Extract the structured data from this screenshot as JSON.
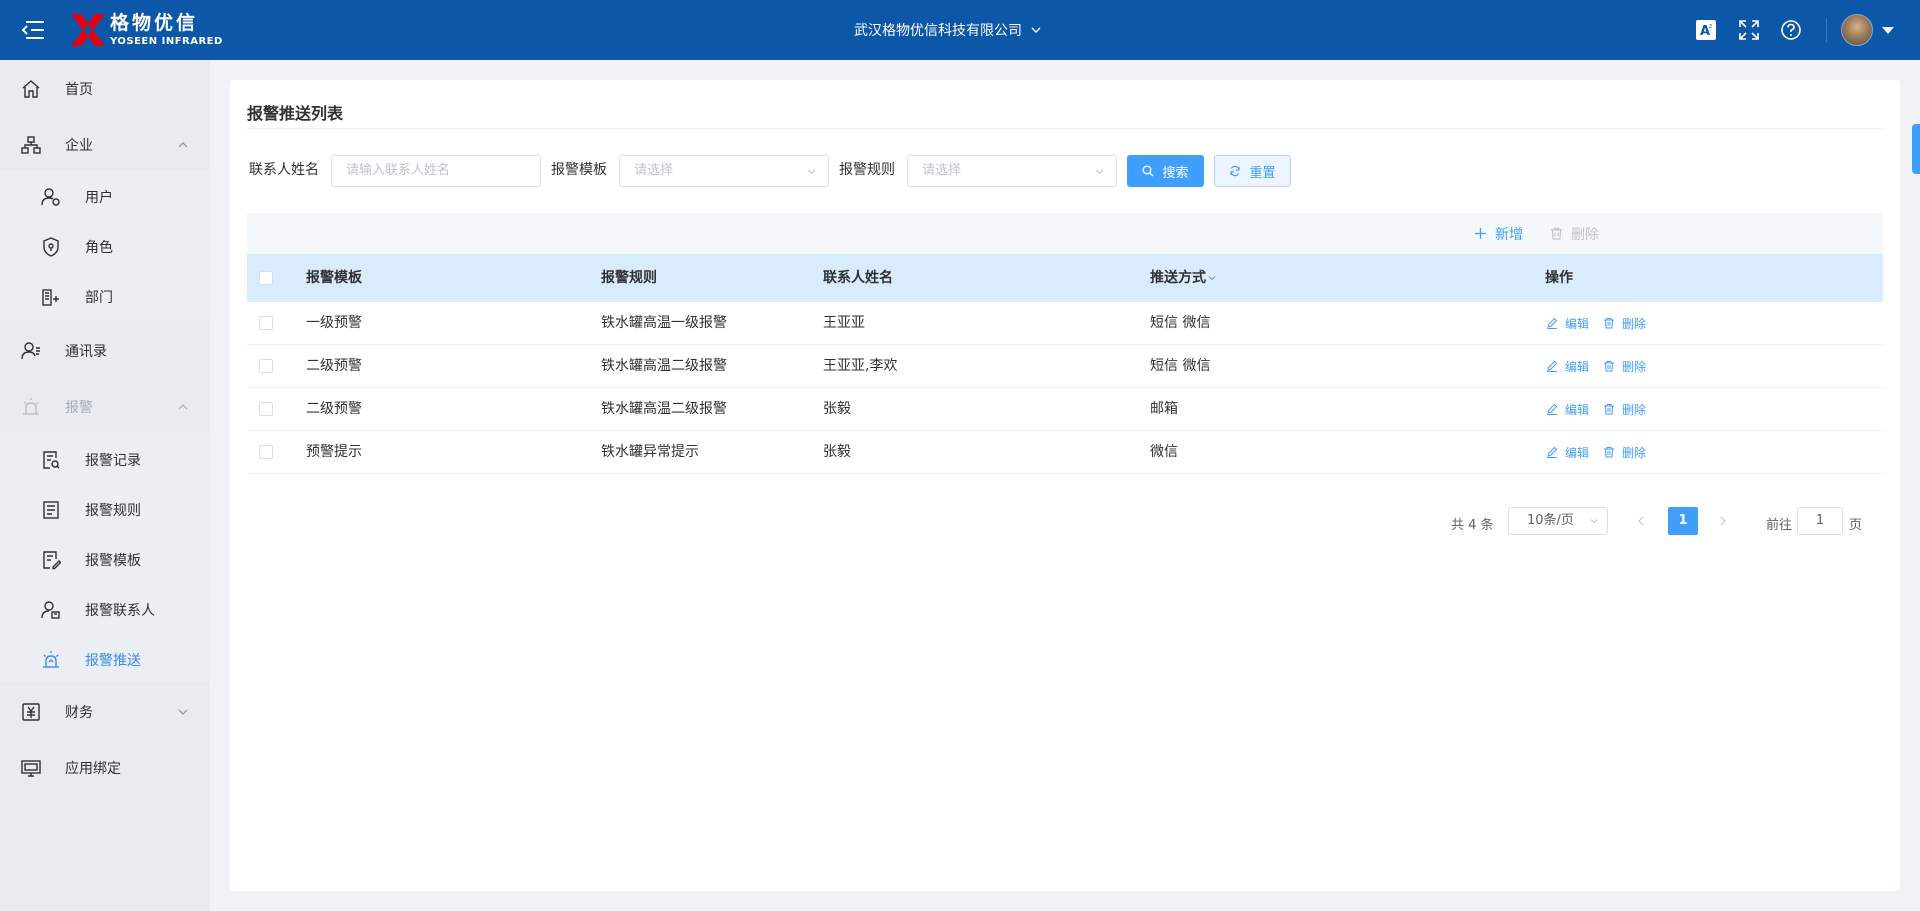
{
  "header": {
    "logo_cn": "格物优信",
    "logo_en": "YOSEEN INFRARED",
    "company": "武汉格物优信科技有限公司"
  },
  "sidebar": {
    "home": "首页",
    "enterprise": "企业",
    "enterprise_items": [
      "用户",
      "角色",
      "部门"
    ],
    "contacts": "通讯录",
    "alarm": "报警",
    "alarm_items": [
      "报警记录",
      "报警规则",
      "报警模板",
      "报警联系人",
      "报警推送"
    ],
    "finance": "财务",
    "app_binding": "应用绑定"
  },
  "page": {
    "title": "报警推送列表"
  },
  "filters": {
    "contact_label": "联系人姓名",
    "contact_placeholder": "请输入联系人姓名",
    "template_label": "报警模板",
    "template_placeholder": "请选择",
    "rule_label": "报警规则",
    "rule_placeholder": "请选择",
    "search_button": "搜索",
    "reset_button": "重置"
  },
  "toolbar": {
    "add": "新增",
    "delete": "删除"
  },
  "table": {
    "columns": [
      "报警模板",
      "报警规则",
      "联系人姓名",
      "推送方式",
      "操作"
    ],
    "rows": [
      {
        "template": "一级预警",
        "rule": "铁水罐高温一级报警",
        "contact": "王亚亚",
        "method": "短信 微信",
        "edit": "编辑",
        "delete": "删除"
      },
      {
        "template": "二级预警",
        "rule": "铁水罐高温二级报警",
        "contact": "王亚亚,李欢",
        "method": "短信 微信",
        "edit": "编辑",
        "delete": "删除"
      },
      {
        "template": "二级预警",
        "rule": "铁水罐高温二级报警",
        "contact": "张毅",
        "method": "邮箱",
        "edit": "编辑",
        "delete": "删除"
      },
      {
        "template": "预警提示",
        "rule": "铁水罐异常提示",
        "contact": "张毅",
        "method": "微信",
        "edit": "编辑",
        "delete": "删除"
      }
    ]
  },
  "pagination": {
    "total": "共 4 条",
    "page_size": "10条/页",
    "current_page": "1",
    "goto_label": "前往",
    "goto_value": "1",
    "goto_suffix": "页"
  },
  "icons": {
    "header": [
      "menu-fold-icon",
      "translate-icon",
      "fullscreen-icon",
      "help-icon"
    ],
    "sidebar": [
      "home-icon",
      "org-icon",
      "user-icon",
      "shield-icon",
      "department-icon",
      "contacts-icon",
      "alarm-icon",
      "record-icon",
      "rule-icon",
      "template-icon",
      "contact-person-icon",
      "push-icon",
      "finance-icon",
      "app-binding-icon"
    ]
  },
  "colors": {
    "header_bg": "#0d57a8",
    "sidebar_bg": "#e8ebf0",
    "primary": "#409eff",
    "table_header_bg": "#d9ecfd"
  }
}
